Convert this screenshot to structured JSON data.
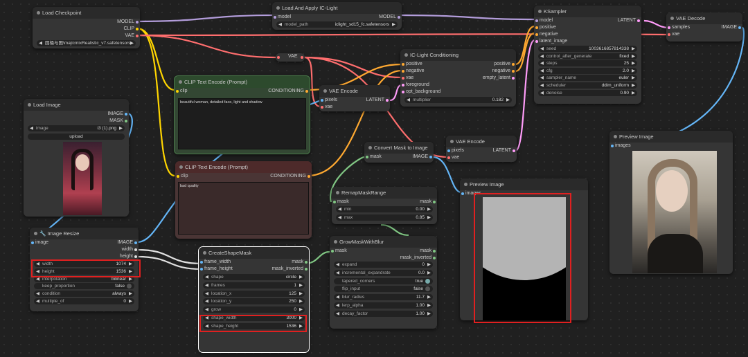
{
  "nodes": {
    "load_checkpoint": {
      "title": "Load Checkpoint",
      "out_model": "MODEL",
      "out_clip": "CLIP",
      "out_vae": "VAE",
      "ckpt_value": "圆桶与图\\majicmixRealistic_v7.safetensors"
    },
    "load_iclight": {
      "title": "Load And Apply IC-Light",
      "in_model": "model",
      "out_model": "MODEL",
      "path_label": "model_path",
      "path_value": "iclight_sd15_fc.safetensors"
    },
    "ksampler": {
      "title": "KSampler",
      "in_model": "model",
      "in_positive": "positive",
      "in_negative": "negative",
      "in_latent": "latent_image",
      "out": "LATENT",
      "widgets": [
        {
          "label": "seed",
          "value": "1003616857814338"
        },
        {
          "label": "control_after_generate",
          "value": "fixed"
        },
        {
          "label": "steps",
          "value": "25"
        },
        {
          "label": "cfg",
          "value": "2.0"
        },
        {
          "label": "sampler_name",
          "value": "euler"
        },
        {
          "label": "scheduler",
          "value": "ddim_uniform"
        },
        {
          "label": "denoise",
          "value": "0.90"
        }
      ]
    },
    "vae_decode_top": {
      "title": "VAE Decode",
      "in_samples": "samples",
      "in_vae": "vae",
      "out": "IMAGE"
    },
    "vae_mini": {
      "title": "VAE"
    },
    "iclight_cond": {
      "title": "IC-Light Conditioning",
      "in_positive": "positive",
      "in_negative": "negative",
      "in_vae": "vae",
      "in_foreground": "foreground",
      "in_opt_bg": "opt_background",
      "out_positive": "positive",
      "out_negative": "negative",
      "out_latent": "empty_latent",
      "mult_label": "multiplier",
      "mult_value": "0.182"
    },
    "clip_pos": {
      "title": "CLIP Text Encode (Prompt)",
      "in_clip": "clip",
      "out": "CONDITIONING",
      "text": "beautiful woman, detailed face, light and shadow"
    },
    "clip_neg": {
      "title": "CLIP Text Encode (Prompt)",
      "in_clip": "clip",
      "out": "CONDITIONING",
      "text": "bad quality"
    },
    "vae_encode_1": {
      "title": "VAE Encode",
      "in_pixels": "pixels",
      "in_vae": "vae",
      "out": "LATENT"
    },
    "vae_encode_2": {
      "title": "VAE Encode",
      "in_pixels": "pixels",
      "in_vae": "vae",
      "out": "LATENT"
    },
    "load_image": {
      "title": "Load Image",
      "out_image": "IMAGE",
      "out_mask": "MASK",
      "image_label": "image",
      "image_value": "i3 (1).png",
      "upload": "upload"
    },
    "convert_mask": {
      "title": "Convert Mask to Image",
      "in_mask": "mask",
      "out": "IMAGE"
    },
    "remap_mask": {
      "title": "RemapMaskRange",
      "in_mask": "mask",
      "out": "mask",
      "min_label": "min",
      "min_value": "0.00",
      "max_label": "max",
      "max_value": "0.85"
    },
    "preview_mid": {
      "title": "Preview Image",
      "in_images": "images"
    },
    "preview_right": {
      "title": "Preview Image",
      "in_images": "images"
    },
    "image_resize": {
      "title": "🔧 Image Resize",
      "in_image": "image",
      "out_image": "IMAGE",
      "out_width": "width",
      "out_height": "height",
      "widgets": [
        {
          "label": "width",
          "value": "1074"
        },
        {
          "label": "height",
          "value": "1536"
        },
        {
          "label": "interpolation",
          "value": "bilinear"
        },
        {
          "label": "keep_proportion",
          "value": "false"
        },
        {
          "label": "condition",
          "value": "always"
        },
        {
          "label": "multiple_of",
          "value": "0"
        }
      ]
    },
    "create_shape_mask": {
      "title": "CreateShapeMask",
      "in_fw": "frame_width",
      "in_fh": "frame_height",
      "out_mask": "mask",
      "out_inv": "mask_inverted",
      "widgets": [
        {
          "label": "shape",
          "value": "circle"
        },
        {
          "label": "frames",
          "value": "1"
        },
        {
          "label": "location_x",
          "value": "125"
        },
        {
          "label": "location_y",
          "value": "250"
        },
        {
          "label": "grow",
          "value": "0"
        },
        {
          "label": "shape_width",
          "value": "3000"
        },
        {
          "label": "shape_height",
          "value": "1536"
        }
      ]
    },
    "grow_mask": {
      "title": "GrowMaskWithBlur",
      "in_mask": "mask",
      "out_mask": "mask",
      "out_inv": "mask_inverted",
      "widgets": [
        {
          "label": "expand",
          "value": "0"
        },
        {
          "label": "incremental_expandrate",
          "value": "0.0"
        },
        {
          "label": "tapered_corners",
          "value": "true"
        },
        {
          "label": "flip_input",
          "value": "false"
        },
        {
          "label": "blur_radius",
          "value": "11.7"
        },
        {
          "label": "lerp_alpha",
          "value": "1.00"
        },
        {
          "label": "decay_factor",
          "value": "1.00"
        }
      ]
    }
  },
  "colors": {
    "model": "#b39ddb",
    "clip": "#ffd500",
    "vae": "#ff6e6e",
    "conditioning": "#ffa931",
    "latent": "#ff9cf9",
    "image": "#64b5f6",
    "mask": "#81c784",
    "highlight": "#e02020"
  }
}
